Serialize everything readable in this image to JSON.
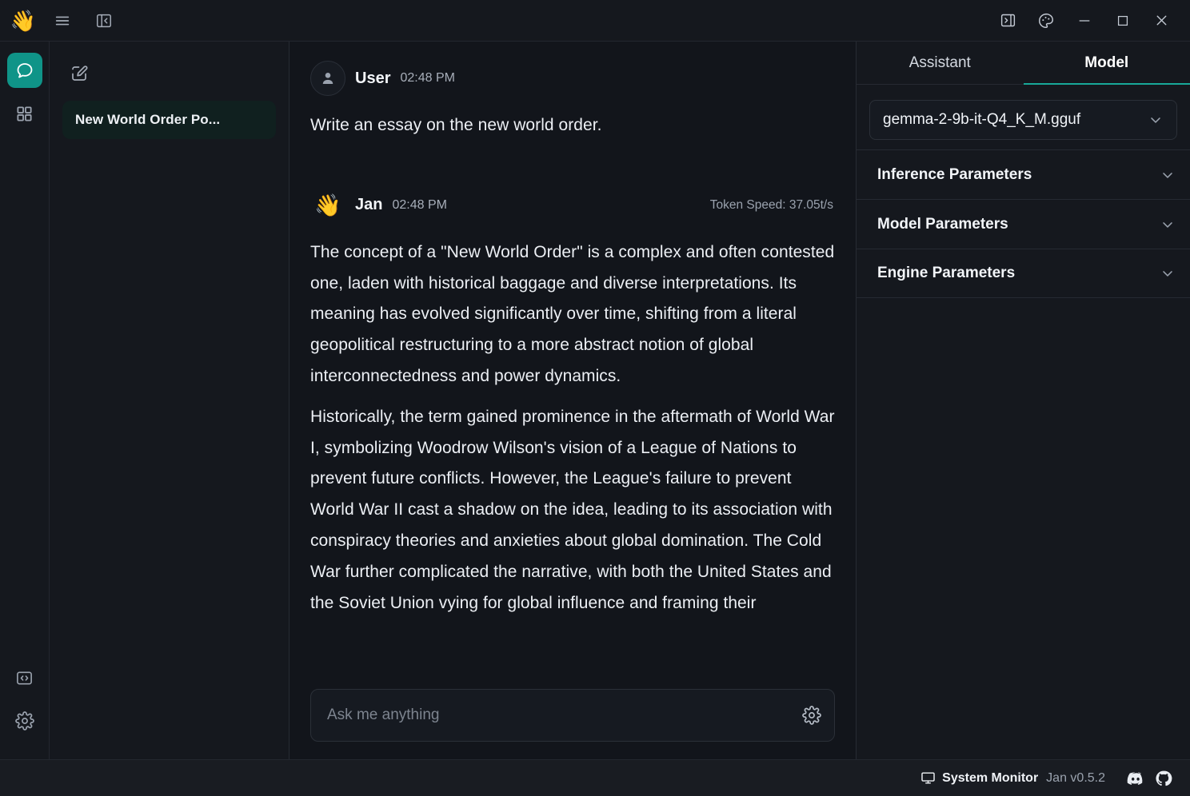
{
  "titlebar": {
    "logo": "wave-emoji",
    "menu_icon": "hamburger-menu-icon",
    "collapse_left_icon": "panel-left-collapse-icon",
    "expand_right_icon": "panel-right-expand-icon",
    "theme_icon": "palette-icon",
    "minimize_icon": "minimize-icon",
    "maximize_icon": "maximize-icon",
    "close_icon": "close-icon"
  },
  "rail": {
    "items": [
      {
        "name": "chat",
        "icon": "chat-bubble-icon",
        "active": true
      },
      {
        "name": "hub",
        "icon": "grid-squares-icon",
        "active": false
      }
    ],
    "bottom_items": [
      {
        "name": "local-api-server",
        "icon": "code-brackets-icon"
      },
      {
        "name": "settings",
        "icon": "gear-icon"
      }
    ]
  },
  "threads": {
    "new_thread_icon": "compose-pencil-icon",
    "items": [
      {
        "title": "New World Order Po...",
        "active": true
      }
    ]
  },
  "chat": {
    "messages": [
      {
        "author": "User",
        "time": "02:48 PM",
        "avatar": "user-avatar-icon",
        "paragraphs": [
          "Write an essay on the new world order."
        ]
      },
      {
        "author": "Jan",
        "time": "02:48 PM",
        "avatar": "wave-emoji",
        "token_speed": "Token Speed: 37.05t/s",
        "paragraphs": [
          "The concept of a \"New World Order\" is a complex and often contested one, laden with historical baggage and diverse interpretations. Its meaning has evolved significantly over time, shifting from a literal geopolitical restructuring to a more abstract notion of global interconnectedness and power dynamics.",
          "Historically, the term gained prominence in the aftermath of World War I, symbolizing Woodrow Wilson's vision of a League of Nations to prevent future conflicts. However, the League's failure to prevent World War II cast a shadow on the idea, leading to its association with conspiracy theories and anxieties about global domination. The Cold War further complicated the narrative, with both the United States and the Soviet Union vying for global influence and framing their"
        ]
      }
    ],
    "composer": {
      "placeholder": "Ask me anything",
      "value": "",
      "settings_icon": "gear-icon"
    }
  },
  "right_panel": {
    "tabs": [
      {
        "label": "Assistant",
        "active": false
      },
      {
        "label": "Model",
        "active": true
      }
    ],
    "model_select": {
      "value": "gemma-2-9b-it-Q4_K_M.gguf",
      "chevron_icon": "chevron-down-icon"
    },
    "sections": [
      {
        "label": "Inference Parameters",
        "chevron_icon": "chevron-down-icon"
      },
      {
        "label": "Model Parameters",
        "chevron_icon": "chevron-down-icon"
      },
      {
        "label": "Engine Parameters",
        "chevron_icon": "chevron-down-icon"
      }
    ]
  },
  "statusbar": {
    "monitor_icon": "monitor-screen-icon",
    "monitor_label": "System Monitor",
    "version": "Jan v0.5.2",
    "discord_icon": "discord-icon",
    "github_icon": "github-icon"
  },
  "colors": {
    "accent": "#0f9488",
    "tab_underline": "#18a999",
    "window_bg": "#15181e",
    "chat_bg": "#12151b",
    "statusbar_bg": "#191c22",
    "thread_active_bg": "#10201f"
  }
}
